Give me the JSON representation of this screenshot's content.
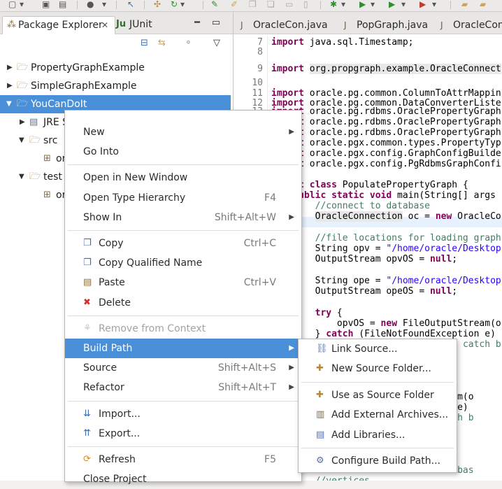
{
  "toolbar": {
    "icons": [
      "new-icon",
      "save-icon",
      "save-all-icon",
      "debug-person-icon",
      "pointer-icon",
      "package-icon",
      "refresh-icon",
      "pin-icon",
      "pen-icon",
      "copy-icon",
      "paste-icon",
      "window-icon",
      "bug-icon",
      "run-icon",
      "run-dropdown-icon",
      "external-tools-icon",
      "open-folder-icon",
      "folder-icon"
    ]
  },
  "package_explorer": {
    "tab_label": "Package Explorer",
    "junit_tab_label": "JUnit",
    "tree": [
      {
        "label": "PropertyGraphExample",
        "expanded": false
      },
      {
        "label": "SimpleGraphExample",
        "expanded": false
      },
      {
        "label": "YouCanDoIt",
        "expanded": true,
        "selected": true
      },
      {
        "label": "JRE S",
        "expanded": false
      },
      {
        "label": "src",
        "expanded": true
      },
      {
        "label": "or",
        "expanded": false
      },
      {
        "label": "test",
        "expanded": true
      },
      {
        "label": "or",
        "expanded": false
      }
    ]
  },
  "editor": {
    "tabs": [
      "OracleCon.java",
      "PopGraph.java",
      "OracleConn"
    ],
    "lines": [
      {
        "n": "7",
        "segments": [
          {
            "t": "import",
            "c": "kw"
          },
          {
            "t": " java.sql.Timestamp;",
            "c": ""
          }
        ]
      },
      {
        "n": "8",
        "segments": []
      },
      {
        "n": "9",
        "segments": [
          {
            "t": "import",
            "c": "kw"
          },
          {
            "t": " ",
            "c": ""
          },
          {
            "t": "org.propgraph.example.OracleConnect",
            "c": "hl"
          }
        ]
      },
      {
        "n": "10",
        "segments": []
      },
      {
        "n": "11",
        "segments": [
          {
            "t": "import",
            "c": "kw"
          },
          {
            "t": " oracle.pg.common.ColumnToAttrMappin",
            "c": ""
          }
        ]
      },
      {
        "n": "12",
        "segments": [
          {
            "t": "import",
            "c": "kw"
          },
          {
            "t": " oracle.pg.common.DataConverterListe",
            "c": ""
          }
        ]
      },
      {
        "n": "13",
        "segments": [
          {
            "t": "import",
            "c": "kw"
          },
          {
            "t": " oracle.pg.rdbms.OraclePropertyGraph",
            "c": ""
          }
        ]
      },
      {
        "n": "",
        "segments": [
          {
            "t": "import",
            "c": "kw"
          },
          {
            "t": " oracle.pg.rdbms.OraclePropertyGraph",
            "c": ""
          }
        ]
      },
      {
        "n": "",
        "segments": [
          {
            "t": "import",
            "c": "kw"
          },
          {
            "t": " oracle.pg.rdbms.OraclePropertyGraph",
            "c": ""
          }
        ]
      },
      {
        "n": "",
        "segments": [
          {
            "t": "import",
            "c": "kw"
          },
          {
            "t": " oracle.pgx.common.types.PropertyTyp",
            "c": ""
          }
        ]
      },
      {
        "n": "",
        "segments": [
          {
            "t": "import",
            "c": "kw"
          },
          {
            "t": " oracle.pgx.config.GraphConfigBuilde",
            "c": ""
          }
        ]
      },
      {
        "n": "",
        "segments": [
          {
            "t": "import",
            "c": "kw"
          },
          {
            "t": " oracle.pgx.config.PgRdbmsGraphConfi",
            "c": ""
          }
        ]
      },
      {
        "n": "",
        "segments": []
      },
      {
        "n": "",
        "segments": [
          {
            "t": "public",
            "c": "kw"
          },
          {
            "t": " ",
            "c": ""
          },
          {
            "t": "class",
            "c": "kw"
          },
          {
            "t": " PopulatePropertyGraph {",
            "c": ""
          }
        ]
      },
      {
        "n": "",
        "segments": [
          {
            "t": "    ",
            "c": ""
          },
          {
            "t": "public",
            "c": "kw"
          },
          {
            "t": " ",
            "c": ""
          },
          {
            "t": "static",
            "c": "kw"
          },
          {
            "t": " ",
            "c": ""
          },
          {
            "t": "void",
            "c": "kw"
          },
          {
            "t": " main(String[] args",
            "c": ""
          }
        ]
      },
      {
        "n": "",
        "segments": [
          {
            "t": "        //connect to database",
            "c": "cmt"
          }
        ]
      },
      {
        "n": "",
        "segments": [
          {
            "t": "        ",
            "c": ""
          },
          {
            "t": "OracleConnection",
            "c": "hl"
          },
          {
            "t": " oc = ",
            "c": ""
          },
          {
            "t": "new",
            "c": "kw"
          },
          {
            "t": " OracleCo",
            "c": ""
          }
        ]
      },
      {
        "n": "",
        "segments": []
      },
      {
        "n": "",
        "segments": [
          {
            "t": "        //file locations for loading graph",
            "c": "cmt"
          }
        ]
      },
      {
        "n": "",
        "segments": [
          {
            "t": "        String opv = ",
            "c": ""
          },
          {
            "t": "\"/home/oracle/Desktop",
            "c": "str"
          }
        ]
      },
      {
        "n": "",
        "segments": [
          {
            "t": "        OutputStream opvOS = ",
            "c": ""
          },
          {
            "t": "null",
            "c": "kw"
          },
          {
            "t": ";",
            "c": ""
          }
        ]
      },
      {
        "n": "",
        "segments": []
      },
      {
        "n": "",
        "segments": [
          {
            "t": "        String ope = ",
            "c": ""
          },
          {
            "t": "\"/home/oracle/Desktop",
            "c": "str"
          }
        ]
      },
      {
        "n": "",
        "segments": [
          {
            "t": "        OutputStream opeOS = ",
            "c": ""
          },
          {
            "t": "null",
            "c": "kw"
          },
          {
            "t": ";",
            "c": ""
          }
        ]
      },
      {
        "n": "",
        "segments": []
      },
      {
        "n": "",
        "segments": [
          {
            "t": "        ",
            "c": ""
          },
          {
            "t": "try",
            "c": "kw"
          },
          {
            "t": " {",
            "c": ""
          }
        ]
      },
      {
        "n": "",
        "segments": [
          {
            "t": "            opvOS = ",
            "c": ""
          },
          {
            "t": "new",
            "c": "kw"
          },
          {
            "t": " FileOutputStream(o",
            "c": ""
          }
        ]
      },
      {
        "n": "",
        "segments": [
          {
            "t": "        } ",
            "c": ""
          },
          {
            "t": "catch",
            "c": "kw"
          },
          {
            "t": " (FileNotFoundException e)",
            "c": ""
          }
        ]
      },
      {
        "n": "",
        "segments": [
          {
            "t": "            // ",
            "c": "cmt"
          },
          {
            "t": "TODO",
            "c": "todo"
          },
          {
            "t": " Auto-generated catch b",
            "c": "cmt"
          }
        ]
      },
      {
        "n": "",
        "segments": []
      },
      {
        "n": "",
        "segments": []
      },
      {
        "n": "",
        "segments": []
      },
      {
        "n": "",
        "segments": []
      },
      {
        "n": "",
        "segments": [
          {
            "t": "                            tStream(o",
            "c": ""
          }
        ]
      },
      {
        "n": "",
        "segments": [
          {
            "t": "                            ption e)",
            "c": ""
          }
        ]
      },
      {
        "n": "",
        "segments": [
          {
            "t": "                            d catch b",
            "c": "cmt"
          }
        ]
      },
      {
        "n": "",
        "segments": []
      },
      {
        "n": "",
        "segments": []
      },
      {
        "n": "",
        "segments": []
      },
      {
        "n": "",
        "segments": [
          {
            "t": "                            ng\"",
            "c": "str"
          },
          {
            "t": ");",
            "c": ""
          }
        ]
      },
      {
        "n": "",
        "segments": [
          {
            "t": "                            n databas",
            "c": "cmt"
          }
        ]
      },
      {
        "n": "",
        "segments": [
          {
            "t": "        //vertices",
            "c": "cmt"
          }
        ]
      }
    ]
  },
  "context_menu": {
    "items": [
      {
        "type": "item",
        "label": "New",
        "submenu": true
      },
      {
        "type": "item",
        "label": "Go Into"
      },
      {
        "type": "sep"
      },
      {
        "type": "item",
        "label": "Open in New Window"
      },
      {
        "type": "item",
        "label": "Open Type Hierarchy",
        "accel": "F4"
      },
      {
        "type": "item",
        "label": "Show In",
        "accel": "Shift+Alt+W",
        "submenu": true
      },
      {
        "type": "sep"
      },
      {
        "type": "item",
        "label": "Copy",
        "accel": "Ctrl+C",
        "icon": "copy-icon"
      },
      {
        "type": "item",
        "label": "Copy Qualified Name",
        "icon": "copy-qualified-icon"
      },
      {
        "type": "item",
        "label": "Paste",
        "accel": "Ctrl+V",
        "icon": "paste-icon"
      },
      {
        "type": "item",
        "label": "Delete",
        "icon": "delete-icon"
      },
      {
        "type": "sep"
      },
      {
        "type": "item",
        "label": "Remove from Context",
        "icon": "remove-context-icon",
        "disabled": true
      },
      {
        "type": "item",
        "label": "Build Path",
        "submenu": true,
        "active": true
      },
      {
        "type": "item",
        "label": "Source",
        "accel": "Shift+Alt+S",
        "submenu": true
      },
      {
        "type": "item",
        "label": "Refactor",
        "accel": "Shift+Alt+T",
        "submenu": true
      },
      {
        "type": "sep"
      },
      {
        "type": "item",
        "label": "Import...",
        "icon": "import-icon"
      },
      {
        "type": "item",
        "label": "Export...",
        "icon": "export-icon"
      },
      {
        "type": "sep"
      },
      {
        "type": "item",
        "label": "Refresh",
        "accel": "F5",
        "icon": "refresh-icon"
      },
      {
        "type": "item",
        "label": "Close Project"
      }
    ]
  },
  "build_path_submenu": {
    "items": [
      {
        "type": "item",
        "label": "Link Source...",
        "icon": "link-source-icon"
      },
      {
        "type": "item",
        "label": "New Source Folder...",
        "icon": "new-source-folder-icon"
      },
      {
        "type": "sep"
      },
      {
        "type": "item",
        "label": "Use as Source Folder",
        "icon": "use-source-folder-icon"
      },
      {
        "type": "item",
        "label": "Add External Archives...",
        "icon": "external-archive-icon"
      },
      {
        "type": "item",
        "label": "Add Libraries...",
        "icon": "libraries-icon"
      },
      {
        "type": "sep"
      },
      {
        "type": "item",
        "label": "Configure Build Path...",
        "icon": "configure-icon"
      }
    ]
  },
  "colors": {
    "selection": "#4a90d9",
    "keyword": "#7f0055",
    "string": "#2a00ff",
    "comment": "#3f7f5f"
  }
}
